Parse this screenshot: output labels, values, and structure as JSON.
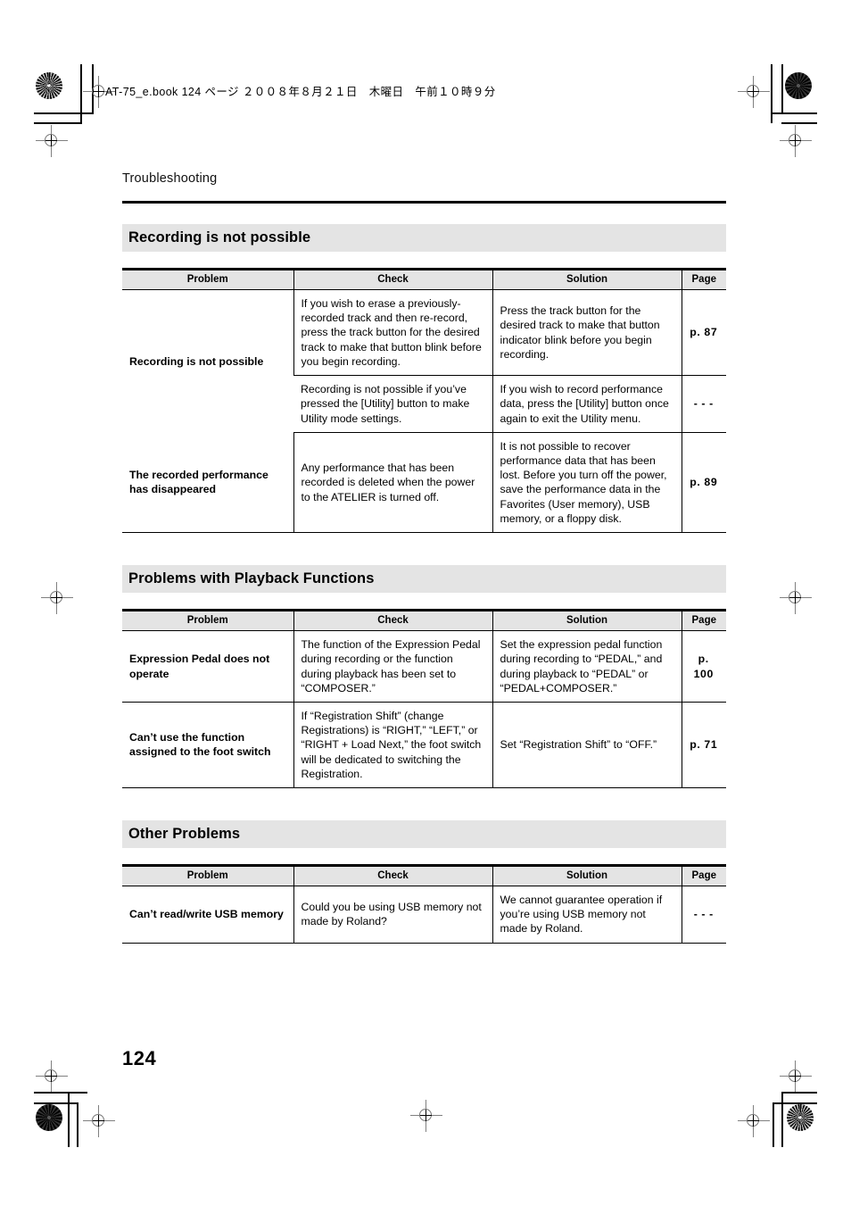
{
  "book_info": "AT-75_e.book  124 ページ  ２００８年８月２１日　木曜日　午前１０時９分",
  "running_head": "Troubleshooting",
  "page_number": "124",
  "table_headers": {
    "problem": "Problem",
    "check": "Check",
    "solution": "Solution",
    "page": "Page"
  },
  "sections": [
    {
      "title": "Recording is not possible",
      "rows": [
        {
          "problem": "Recording is not possible",
          "check": "If you wish to erase a previously-recorded track and then re-record, press the track button for the desired track to make that button blink before you begin recording.",
          "solution": "Press the track button for the desired track to make that button indicator blink before you begin recording.",
          "page": "p. 87"
        },
        {
          "problem": "",
          "check": "Recording is not possible if you’ve pressed the [Utility] button to make Utility mode settings.",
          "solution": "If you wish to record performance data, press the [Utility] button once again to exit the Utility menu.",
          "page": "- - -"
        },
        {
          "problem": "The recorded performance has disappeared",
          "check": "Any performance that has been recorded is deleted when the power to the ATELIER is turned off.",
          "solution": "It is not possible to recover performance data that has been lost. Before you turn off the power, save the performance data in the Favorites (User memory), USB memory, or a floppy disk.",
          "page": "p. 89"
        }
      ]
    },
    {
      "title": "Problems with Playback Functions",
      "rows": [
        {
          "problem": "Expression Pedal does not operate",
          "check": "The function of the Expression Pedal during recording or the function during playback has been set to “COMPOSER.”",
          "solution": "Set the expression pedal function during recording to “PEDAL,” and during playback to “PEDAL” or “PEDAL+COMPOSER.”",
          "page": "p. 100"
        },
        {
          "problem": "Can’t use the function assigned to the foot switch",
          "check": "If “Registration Shift” (change Registrations) is “RIGHT,” “LEFT,” or “RIGHT + Load Next,” the foot switch will be dedicated to switching the Registration.",
          "solution": "Set “Registration Shift” to “OFF.”",
          "page": "p. 71"
        }
      ]
    },
    {
      "title": "Other Problems",
      "rows": [
        {
          "problem": "Can’t read/write USB memory",
          "check": "Could you be using USB memory not made by Roland?",
          "solution": "We cannot guarantee operation if you’re using USB memory not made by Roland.",
          "page": "- - -"
        }
      ]
    }
  ]
}
